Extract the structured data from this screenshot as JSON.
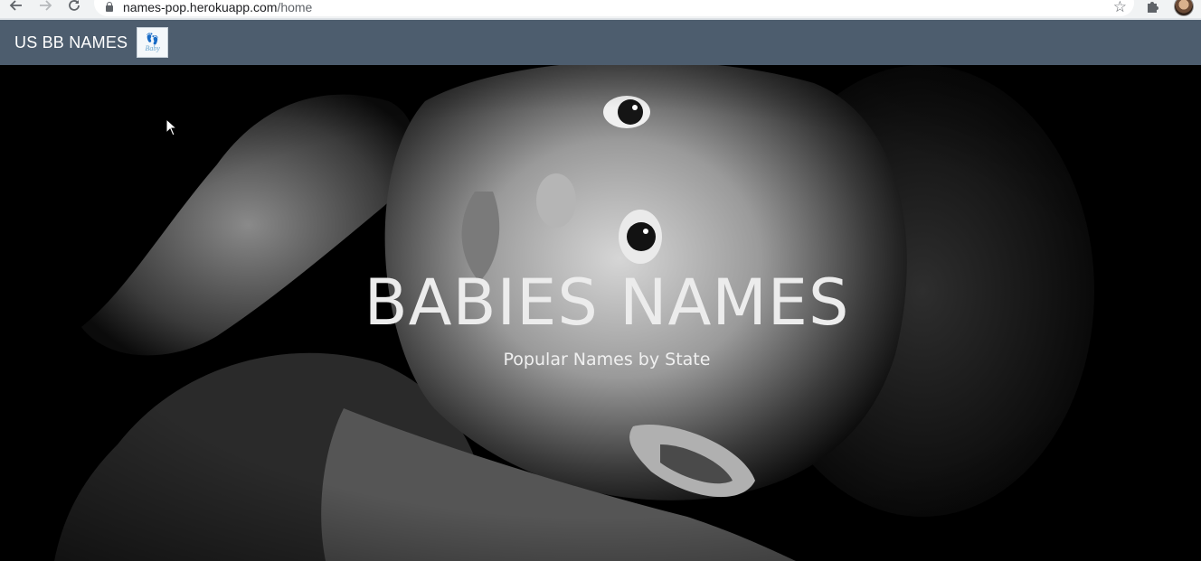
{
  "browser": {
    "back_icon": "arrow-left-icon",
    "forward_icon": "arrow-right-icon",
    "reload_icon": "reload-icon",
    "url_host": "names-pop.herokuapp.com",
    "url_path": "/home",
    "bookmark_icon": "star-icon",
    "extensions_icon": "puzzle-icon"
  },
  "navbar": {
    "brand": "US BB NAMES",
    "logo_text": "Baby",
    "logo_icon": "baby-feet-icon",
    "bg_color": "#4d5d6e"
  },
  "hero": {
    "title": "BABIES NAMES",
    "subtitle": "Popular Names by State",
    "image": "black-and-white-baby-photo"
  }
}
